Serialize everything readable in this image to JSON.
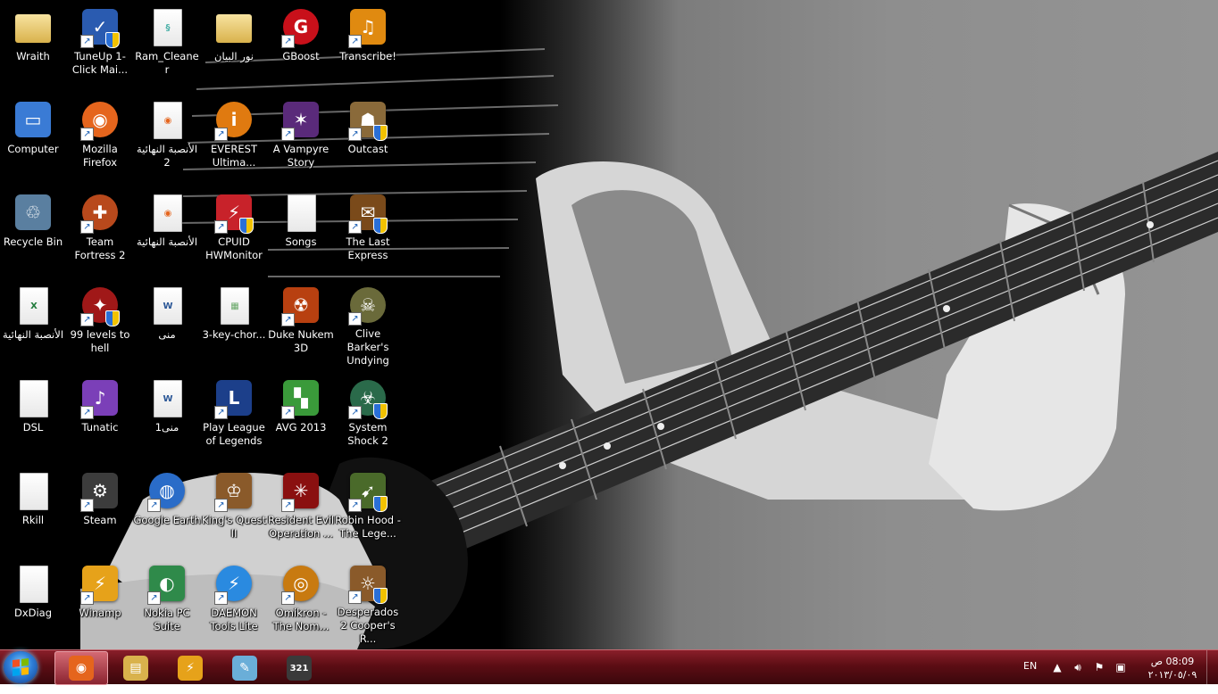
{
  "desktop": {
    "icons": [
      {
        "label": "Wraith",
        "icon": "user-folder-icon",
        "color": "#d9b24c",
        "glyph": "",
        "kind": "folder",
        "shortcut": false,
        "shield": false
      },
      {
        "label": "Computer",
        "icon": "computer-icon",
        "color": "#3a7bd5",
        "glyph": "▭",
        "kind": "box",
        "shortcut": false,
        "shield": false
      },
      {
        "label": "Recycle Bin",
        "icon": "recycle-bin-icon",
        "color": "#5a7fa0",
        "glyph": "♲",
        "kind": "box",
        "shortcut": false,
        "shield": false
      },
      {
        "label": "الأنصبة النهائية",
        "icon": "excel-icon",
        "color": "#1f7a3a",
        "glyph": "X",
        "kind": "doc",
        "shortcut": false,
        "shield": false
      },
      {
        "label": "DSL",
        "icon": "blank-file-icon",
        "color": "#ffffff",
        "glyph": "",
        "kind": "doc",
        "shortcut": false,
        "shield": false
      },
      {
        "label": "Rkill",
        "icon": "blank-file-icon",
        "color": "#ffffff",
        "glyph": "",
        "kind": "doc",
        "shortcut": false,
        "shield": false
      },
      {
        "label": "DxDiag",
        "icon": "blank-file-icon",
        "color": "#ffffff",
        "glyph": "",
        "kind": "doc",
        "shortcut": false,
        "shield": false
      },
      {
        "label": "TuneUp 1-Click Mai...",
        "icon": "tuneup-icon",
        "color": "#2a5bb0",
        "glyph": "✓",
        "kind": "box",
        "shortcut": true,
        "shield": true
      },
      {
        "label": "Mozilla Firefox",
        "icon": "firefox-icon",
        "color": "#e5651d",
        "glyph": "◉",
        "kind": "round",
        "shortcut": true,
        "shield": false
      },
      {
        "label": "Team Fortress 2",
        "icon": "team-fortress-icon",
        "color": "#b8491c",
        "glyph": "✚",
        "kind": "round",
        "shortcut": true,
        "shield": false
      },
      {
        "label": "99 levels to hell",
        "icon": "game-icon",
        "color": "#a01818",
        "glyph": "✦",
        "kind": "round",
        "shortcut": true,
        "shield": true
      },
      {
        "label": "Tunatic",
        "icon": "music-note-icon",
        "color": "#7b3fb8",
        "glyph": "♪",
        "kind": "box",
        "shortcut": true,
        "shield": false
      },
      {
        "label": "Steam",
        "icon": "steam-icon",
        "color": "#3c3c3c",
        "glyph": "⚙",
        "kind": "box",
        "shortcut": true,
        "shield": false
      },
      {
        "label": "Winamp",
        "icon": "winamp-icon",
        "color": "#e6a21a",
        "glyph": "⚡",
        "kind": "box",
        "shortcut": true,
        "shield": false
      },
      {
        "label": "Ram_Cleaner",
        "icon": "script-icon",
        "color": "#4ab0a8",
        "glyph": "§",
        "kind": "doc",
        "shortcut": false,
        "shield": false
      },
      {
        "label": "الأنصبة النهائية 2",
        "icon": "firefox-html-icon",
        "color": "#e5651d",
        "glyph": "◉",
        "kind": "doc",
        "shortcut": false,
        "shield": false
      },
      {
        "label": "الأنصبة النهائية",
        "icon": "firefox-html-icon",
        "color": "#e5651d",
        "glyph": "◉",
        "kind": "doc",
        "shortcut": false,
        "shield": false
      },
      {
        "label": "منى",
        "icon": "word-doc-icon",
        "color": "#2b5797",
        "glyph": "W",
        "kind": "doc",
        "shortcut": false,
        "shield": false
      },
      {
        "label": "1منى",
        "icon": "word-doc-icon",
        "color": "#2b5797",
        "glyph": "W",
        "kind": "doc",
        "shortcut": false,
        "shield": false
      },
      {
        "label": "Google Earth",
        "icon": "google-earth-icon",
        "color": "#2a6cc8",
        "glyph": "◍",
        "kind": "round",
        "shortcut": true,
        "shield": false
      },
      {
        "label": "Nokia PC Suite",
        "icon": "nokia-icon",
        "color": "#2f8a4a",
        "glyph": "◐",
        "kind": "box",
        "shortcut": true,
        "shield": false
      },
      {
        "label": "نور البيان",
        "icon": "folder-icon",
        "color": "#d9b24c",
        "glyph": "",
        "kind": "folder",
        "shortcut": false,
        "shield": false
      },
      {
        "label": "EVEREST Ultima...",
        "icon": "everest-icon",
        "color": "#e07a10",
        "glyph": "i",
        "kind": "round",
        "shortcut": true,
        "shield": false
      },
      {
        "label": "CPUID HWMonitor",
        "icon": "hwmonitor-icon",
        "color": "#c8222a",
        "glyph": "⚡",
        "kind": "box",
        "shortcut": true,
        "shield": true
      },
      {
        "label": "3-key-chor...",
        "icon": "image-file-icon",
        "color": "#6aa86a",
        "glyph": "▦",
        "kind": "doc",
        "shortcut": false,
        "shield": false
      },
      {
        "label": "Play League of Legends",
        "icon": "league-icon",
        "color": "#1c3f8a",
        "glyph": "L",
        "kind": "box",
        "shortcut": true,
        "shield": false
      },
      {
        "label": "King's Quest II",
        "icon": "kings-quest-icon",
        "color": "#8a5a2a",
        "glyph": "♔",
        "kind": "box",
        "shortcut": true,
        "shield": false
      },
      {
        "label": "DAEMON Tools Lite",
        "icon": "daemon-tools-icon",
        "color": "#2a8ae0",
        "glyph": "⚡",
        "kind": "round",
        "shortcut": true,
        "shield": false
      },
      {
        "label": "GBoost",
        "icon": "gboost-icon",
        "color": "#c8101a",
        "glyph": "G",
        "kind": "round",
        "shortcut": true,
        "shield": false
      },
      {
        "label": "A Vampyre Story",
        "icon": "vampyre-icon",
        "color": "#5a2a7a",
        "glyph": "✶",
        "kind": "box",
        "shortcut": true,
        "shield": false
      },
      {
        "label": "Songs",
        "icon": "blank-file-icon",
        "color": "#ffffff",
        "glyph": "",
        "kind": "doc",
        "shortcut": false,
        "shield": false
      },
      {
        "label": "Duke Nukem 3D",
        "icon": "duke-nukem-icon",
        "color": "#b84010",
        "glyph": "☢",
        "kind": "box",
        "shortcut": true,
        "shield": false
      },
      {
        "label": "AVG 2013",
        "icon": "avg-icon",
        "color": "#3a9a3a",
        "glyph": "▚",
        "kind": "box",
        "shortcut": true,
        "shield": false
      },
      {
        "label": "Resident Evil Operation ...",
        "icon": "umbrella-icon",
        "color": "#8a1010",
        "glyph": "✳",
        "kind": "box",
        "shortcut": true,
        "shield": false
      },
      {
        "label": "Omikron - The Nom...",
        "icon": "omikron-icon",
        "color": "#c87a10",
        "glyph": "◎",
        "kind": "round",
        "shortcut": true,
        "shield": false
      },
      {
        "label": "Transcribe!",
        "icon": "transcribe-icon",
        "color": "#e08a10",
        "glyph": "♫",
        "kind": "box",
        "shortcut": true,
        "shield": false
      },
      {
        "label": "Outcast",
        "icon": "outcast-icon",
        "color": "#8a6a3a",
        "glyph": "☗",
        "kind": "box",
        "shortcut": true,
        "shield": true
      },
      {
        "label": "The Last Express",
        "icon": "last-express-icon",
        "color": "#7a4a1a",
        "glyph": "✉",
        "kind": "box",
        "shortcut": true,
        "shield": true
      },
      {
        "label": "Clive Barker's Undying",
        "icon": "undying-icon",
        "color": "#6a6a3a",
        "glyph": "☠",
        "kind": "round",
        "shortcut": true,
        "shield": false
      },
      {
        "label": "System Shock 2",
        "icon": "system-shock-icon",
        "color": "#2a6a4a",
        "glyph": "☣",
        "kind": "round",
        "shortcut": true,
        "shield": true
      },
      {
        "label": "Robin Hood - The Lege...",
        "icon": "robin-hood-icon",
        "color": "#4a6a2a",
        "glyph": "➹",
        "kind": "box",
        "shortcut": true,
        "shield": true
      },
      {
        "label": "Desperados 2 Cooper's R...",
        "icon": "desperados-icon",
        "color": "#8a5a2a",
        "glyph": "☼",
        "kind": "box",
        "shortcut": true,
        "shield": true
      }
    ]
  },
  "taskbar": {
    "start_label": "Start",
    "pinned": [
      {
        "name": "firefox",
        "icon": "firefox-icon",
        "color": "#e5651d",
        "glyph": "◉",
        "active": true
      },
      {
        "name": "explorer",
        "icon": "folder-icon",
        "color": "#d9b24c",
        "glyph": "▤",
        "active": false
      },
      {
        "name": "winamp",
        "icon": "winamp-icon",
        "color": "#e6a21a",
        "glyph": "⚡",
        "active": false
      },
      {
        "name": "notepad",
        "icon": "notepad-icon",
        "color": "#6aaed8",
        "glyph": "✎",
        "active": false
      },
      {
        "name": "media-player-classic",
        "icon": "media-player-icon",
        "color": "#3a3a3a",
        "glyph": "321",
        "active": false
      }
    ],
    "tray": {
      "language": "EN",
      "time": "08:09 ص",
      "date": "٢٠١٣/٠٥/٠٩"
    }
  }
}
